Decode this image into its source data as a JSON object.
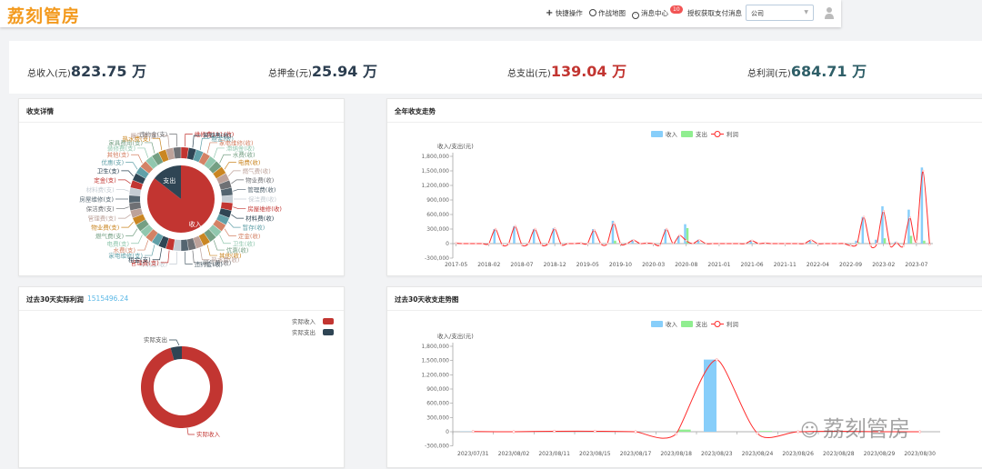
{
  "header": {
    "logo": "荔刻管房",
    "quick_action": "快捷操作",
    "battle_map": "作战地图",
    "message_center": "消息中心",
    "message_count": "10",
    "auth_payment": "授权获取支付消息",
    "company_select": "公司"
  },
  "stats": [
    {
      "label": "总收入(元)",
      "value": "823.75 万",
      "color": "#2c3e50"
    },
    {
      "label": "总押金(元)",
      "value": "25.94 万",
      "color": "#2c3e50"
    },
    {
      "label": "总支出(元)",
      "value": "139.04 万",
      "color": "#c23531"
    },
    {
      "label": "总利润(元)",
      "value": "684.71 万",
      "color": "#2f5f68"
    }
  ],
  "palette": [
    "#c23531",
    "#2f4554",
    "#61a0a8",
    "#d48265",
    "#91c7ae",
    "#749f83",
    "#ca8622",
    "#bda29a",
    "#6e7074",
    "#546570",
    "#c4ccd3"
  ],
  "detail_card": {
    "title": "收支详情",
    "inner": [
      {
        "name": "收入",
        "value": 823.75
      },
      {
        "name": "支出",
        "value": 139.04
      }
    ],
    "outer_labels": [
      "维修费111(收)",
      "管理费(收)",
      "租金(收)",
      "家电维修(收)",
      "滞纳金(收)",
      "水费(收)",
      "电费(收)",
      "燃气费(收)",
      "物业费(收)",
      "管理费(收)",
      "保洁费(收)",
      "房屋维修(收)",
      "材料费(收)",
      "暂存(收)",
      "定金(收)",
      "卫生(收)",
      "优惠(收)",
      "其他(收)",
      "热水费(收)",
      "暖气费(收)",
      "违约金(收)",
      "滞纳金(收)",
      "管理费(支)",
      "租金(支)",
      "家电维修(支)",
      "水费(支)",
      "电费(支)",
      "燃气费(支)",
      "物业费(支)",
      "管理费(支)",
      "保洁费(支)",
      "房屋维修(支)",
      "材料费(支)",
      "定金(支)",
      "卫生(支)",
      "优惠(支)",
      "其他(支)",
      "装修费(支)",
      "家具费用(支)",
      "热水费(支)",
      "暖气费(支)",
      "违约金(支)"
    ]
  },
  "profit_card": {
    "title": "过去30天实际利润",
    "profit": "1515496.24",
    "legend": [
      "实际收入",
      "实际支出"
    ],
    "slices": [
      {
        "name": "实际收入",
        "value": 1590000,
        "color": "#c23531"
      },
      {
        "name": "实际支出",
        "value": 74500,
        "color": "#2f4554"
      }
    ]
  },
  "watermark": "荔刻管房",
  "chart_data": [
    {
      "type": "bar",
      "title": "全年收支走势",
      "ylabel": "收入/支出(元)",
      "ylim": [
        -300000,
        1800000
      ],
      "yticks": [
        "1,800,000",
        "1,500,000",
        "1,200,000",
        "900,000",
        "600,000",
        "300,000",
        "0",
        "-300,000"
      ],
      "legend": [
        "收入",
        "支出",
        "利润"
      ],
      "colors": {
        "收入": "#87cefa",
        "支出": "#90ee90",
        "利润": "#ff2a2a"
      },
      "x_tick_labels": [
        "2017-05",
        "2018-02",
        "2018-07",
        "2018-12",
        "2019-05",
        "2019-10",
        "2020-03",
        "2020-08",
        "2021-01",
        "2021-06",
        "2021-11",
        "2022-04",
        "2022-09",
        "2023-02",
        "2023-07"
      ],
      "category_count": 73,
      "series": [
        {
          "name": "收入",
          "points": [
            [
              6,
              300000
            ],
            [
              9,
              360000
            ],
            [
              12,
              300000
            ],
            [
              15,
              320000
            ],
            [
              21,
              300000
            ],
            [
              24,
              470000
            ],
            [
              27,
              80000
            ],
            [
              32,
              300000
            ],
            [
              34,
              150000
            ],
            [
              35,
              400000
            ],
            [
              37,
              80000
            ],
            [
              45,
              70000
            ],
            [
              54,
              70000
            ],
            [
              61,
              60000
            ],
            [
              62,
              550000
            ],
            [
              64,
              80000
            ],
            [
              65,
              770000
            ],
            [
              67,
              40000
            ],
            [
              69,
              700000
            ],
            [
              71,
              1570000
            ]
          ]
        },
        {
          "name": "支出",
          "points": [
            [
              24,
              60000
            ],
            [
              35,
              320000
            ],
            [
              61,
              30000
            ],
            [
              65,
              110000
            ],
            [
              69,
              160000
            ],
            [
              71,
              60000
            ]
          ]
        },
        {
          "name": "利润",
          "points": [
            [
              0,
              10000
            ],
            [
              5,
              0
            ],
            [
              6,
              300000
            ],
            [
              7,
              -20000
            ],
            [
              9,
              360000
            ],
            [
              10,
              -20000
            ],
            [
              12,
              300000
            ],
            [
              13,
              -20000
            ],
            [
              15,
              310000
            ],
            [
              16,
              -20000
            ],
            [
              19,
              10000
            ],
            [
              21,
              280000
            ],
            [
              22,
              0
            ],
            [
              24,
              420000
            ],
            [
              25,
              0
            ],
            [
              27,
              70000
            ],
            [
              29,
              10000
            ],
            [
              31,
              -30000
            ],
            [
              32,
              300000
            ],
            [
              33,
              0
            ],
            [
              34,
              170000
            ],
            [
              35,
              60000
            ],
            [
              37,
              70000
            ],
            [
              39,
              0
            ],
            [
              45,
              60000
            ],
            [
              47,
              10000
            ],
            [
              54,
              70000
            ],
            [
              55,
              0
            ],
            [
              60,
              -40000
            ],
            [
              62,
              550000
            ],
            [
              63,
              -30000
            ],
            [
              65,
              670000
            ],
            [
              66,
              -40000
            ],
            [
              67,
              20000
            ],
            [
              68,
              -50000
            ],
            [
              69,
              540000
            ],
            [
              70,
              50000
            ],
            [
              71,
              1500000
            ],
            [
              72,
              -20000
            ]
          ]
        }
      ]
    },
    {
      "type": "bar",
      "title": "过去30天收支走势图",
      "ylabel": "收入/支出(元)",
      "ylim": [
        -300000,
        1800000
      ],
      "yticks": [
        "1,800,000",
        "1,500,000",
        "1,200,000",
        "900,000",
        "600,000",
        "300,000",
        "0",
        "-300,000"
      ],
      "legend": [
        "收入",
        "支出",
        "利润"
      ],
      "colors": {
        "收入": "#87cefa",
        "支出": "#90ee90",
        "利润": "#ff2a2a"
      },
      "categories": [
        "2023/07/31",
        "2023/08/02",
        "2023/08/11",
        "2023/08/15",
        "2023/08/17",
        "2023/08/18",
        "2023/08/23",
        "2023/08/24",
        "2023/08/26",
        "2023/08/28",
        "2023/08/29",
        "2023/08/30"
      ],
      "series": [
        {
          "name": "收入",
          "values": [
            5000,
            0,
            10000,
            10000,
            0,
            0,
            1520000,
            0,
            0,
            10000,
            0,
            0
          ]
        },
        {
          "name": "支出",
          "values": [
            0,
            0,
            0,
            0,
            0,
            45000,
            0,
            15000,
            0,
            0,
            0,
            0
          ]
        },
        {
          "name": "利润",
          "values": [
            5000,
            0,
            10000,
            10000,
            0,
            -45000,
            1515000,
            -30000,
            0,
            10000,
            0,
            0
          ]
        }
      ]
    }
  ]
}
